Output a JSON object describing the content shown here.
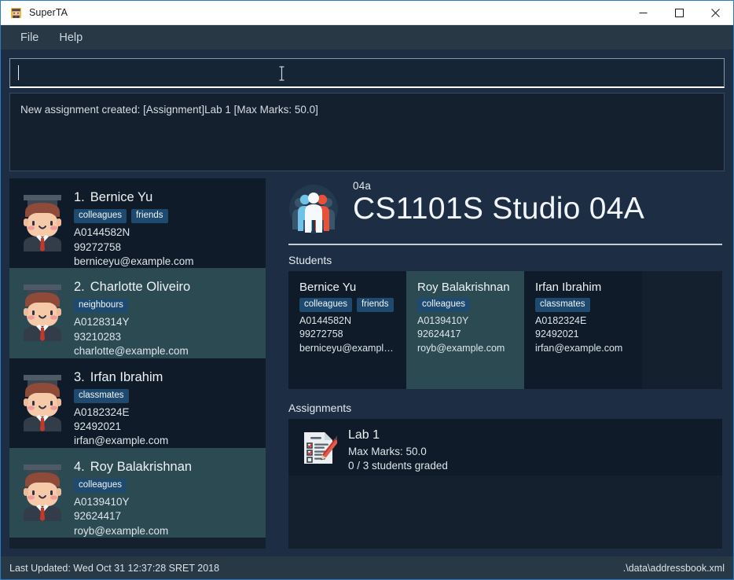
{
  "window": {
    "title": "SuperTA",
    "app_icon": "graduate-avatar-icon",
    "minimize_label": "Minimize",
    "maximize_label": "Maximize",
    "close_label": "Close"
  },
  "menubar": {
    "items": [
      {
        "label": "File",
        "name": "menu-file"
      },
      {
        "label": "Help",
        "name": "menu-help"
      }
    ]
  },
  "command": {
    "value": "",
    "placeholder": "",
    "result": "New assignment created: [Assignment]Lab 1 [Max Marks: 50.0]"
  },
  "person_list": [
    {
      "index": "1.",
      "name": "Bernice Yu",
      "tags": [
        "colleagues",
        "friends"
      ],
      "id": "A0144582N",
      "phone": "99272758",
      "email": "berniceyu@example.com",
      "selected": false
    },
    {
      "index": "2.",
      "name": "Charlotte Oliveiro",
      "tags": [
        "neighbours"
      ],
      "id": "A0128314Y",
      "phone": "93210283",
      "email": "charlotte@example.com",
      "selected": true
    },
    {
      "index": "3.",
      "name": "Irfan Ibrahim",
      "tags": [
        "classmates"
      ],
      "id": "A0182324E",
      "phone": "92492021",
      "email": "irfan@example.com",
      "selected": false
    },
    {
      "index": "4.",
      "name": "Roy Balakrishnan",
      "tags": [
        "colleagues"
      ],
      "id": "A0139410Y",
      "phone": "92624417",
      "email": "royb@example.com",
      "selected": true
    }
  ],
  "detail": {
    "icon": "group-of-people-icon",
    "subtitle": "04a",
    "title": "CS1101S Studio 04A",
    "students_label": "Students",
    "assignments_label": "Assignments",
    "students": [
      {
        "name": "Bernice Yu",
        "tags": [
          "colleagues",
          "friends"
        ],
        "id": "A0144582N",
        "phone": "99272758",
        "email": "berniceyu@example....",
        "selected": false
      },
      {
        "name": "Roy Balakrishnan",
        "tags": [
          "colleagues"
        ],
        "id": "A0139410Y",
        "phone": "92624417",
        "email": "royb@example.com",
        "selected": true
      },
      {
        "name": "Irfan Ibrahim",
        "tags": [
          "classmates"
        ],
        "id": "A0182324E",
        "phone": "92492021",
        "email": "irfan@example.com",
        "selected": false
      }
    ],
    "assignments": [
      {
        "icon": "checklist-document-icon",
        "title": "Lab 1",
        "max_marks": "Max Marks: 50.0",
        "graded": "0 / 3 students graded"
      }
    ]
  },
  "statusbar": {
    "last_updated": "Last Updated: Wed Oct 31 12:37:28 SRET 2018",
    "file_path": ".\\data\\addressbook.xml"
  },
  "colors": {
    "window_border": "#2a7ac4",
    "chrome": "#283845",
    "panel_bg": "#14202e",
    "card_bg": "#0f1b28",
    "card_selected": "#2c4a52",
    "tag_bg": "#1d4a6e",
    "text": "#dde4ea",
    "accent_red": "#e8503a",
    "accent_blue": "#6fc3e8"
  }
}
